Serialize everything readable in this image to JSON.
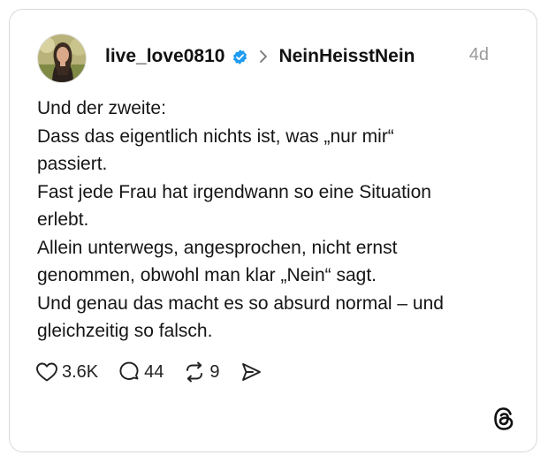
{
  "post": {
    "author": "live_love0810",
    "topic": "NeinHeisstNein",
    "age": "4d",
    "lines": [
      "Und der zweite:",
      "Dass das eigentlich nichts ist, was „nur mir“",
      "passiert.",
      "Fast jede Frau hat irgendwann so eine Situation",
      "erlebt.",
      "Allein unterwegs, angesprochen, nicht ernst",
      "genommen, obwohl man klar „Nein“ sagt.",
      "Und genau das macht es so absurd normal – und",
      "gleichzeitig so falsch."
    ]
  },
  "actions": {
    "likes": "3.6K",
    "replies": "44",
    "reposts": "9"
  },
  "icons": {
    "verified": "verified-badge-icon",
    "separator": "chevron-right-icon",
    "like": "heart-icon",
    "reply": "comment-icon",
    "repost": "repost-icon",
    "share": "send-icon",
    "brand": "threads-logo-icon"
  },
  "colors": {
    "verified": "#1d9bf0",
    "timestamp": "#9a9a9a",
    "card_border": "#d9d9d9"
  }
}
